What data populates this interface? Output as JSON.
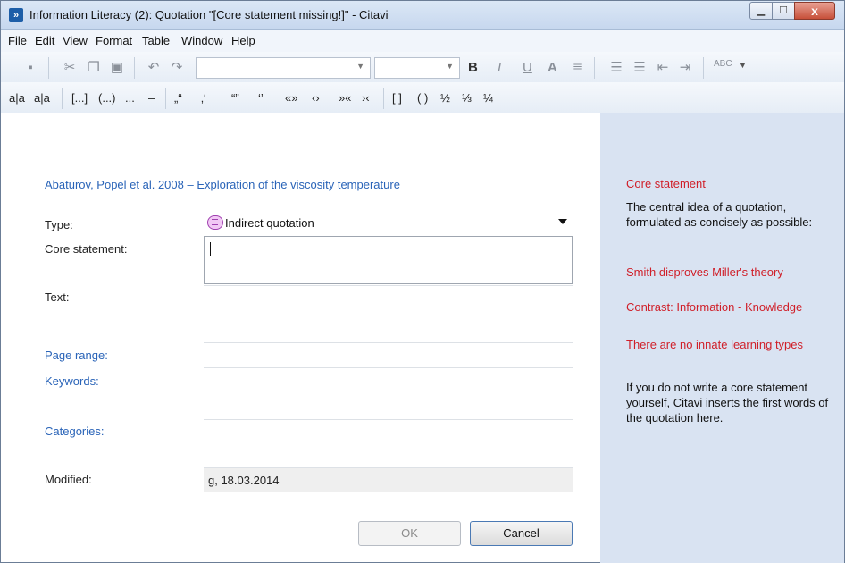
{
  "window": {
    "title": "Information Literacy (2): Quotation \"[Core statement missing!]\" - Citavi",
    "app_icon": "citavi-icon",
    "controls": {
      "minimize_icon": "minimize-icon",
      "maximize_icon": "maximize-icon",
      "close_icon": "close-icon",
      "close_glyph": "x"
    }
  },
  "menu": [
    "File",
    "Edit",
    "View",
    "Format",
    "Table",
    "Window",
    "Help"
  ],
  "toolbar1": {
    "font_combo_value": "",
    "size_combo_value": "",
    "bold": "B",
    "italic": "I",
    "underline": "U",
    "text_color": "A",
    "spellcheck": "ABC"
  },
  "toolbar2": {
    "chars": [
      "a|a",
      "a|a",
      "[...]",
      "(...)",
      "...",
      "–",
      "„“",
      "‚‘",
      "“”",
      "‘’",
      "«»",
      "‹›",
      "»«",
      "›‹",
      "[ ]",
      "( )",
      "½",
      "⅓",
      "¼"
    ]
  },
  "form": {
    "reference": "Abaturov, Popel et al. 2008 – Exploration of the viscosity temperature",
    "type_label": "Type:",
    "type_value": "Indirect quotation",
    "core_label": "Core statement:",
    "core_value": "",
    "text_label": "Text:",
    "page_range_label": "Page range:",
    "keywords_label": "Keywords:",
    "categories_label": "Categories:",
    "modified_label": "Modified:",
    "modified_value": "g, 18.03.2014",
    "ok_label": "OK",
    "cancel_label": "Cancel"
  },
  "help": {
    "heading": "Core statement",
    "intro": "The central idea of a quotation, formulated as concisely as possible:",
    "example1": "Smith disproves Miller's theory",
    "example2": "Contrast: Information - Knowledge",
    "example3": "There are no innate learning types",
    "note": "If you do not write a core statement yourself, Citavi inserts the first words of the quotation here.",
    "colors": {
      "example": "#d0202a",
      "background": "#d9e3f2"
    }
  }
}
